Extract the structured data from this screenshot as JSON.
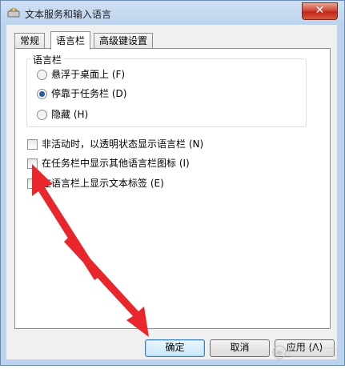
{
  "window": {
    "title": "文本服务和输入语言",
    "close_glyph": "✕"
  },
  "tabs": [
    {
      "label": "常规",
      "active": false
    },
    {
      "label": "语言栏",
      "active": true
    },
    {
      "label": "高级键设置",
      "active": false
    }
  ],
  "language_bar_group": {
    "legend": "语言栏",
    "options": [
      {
        "label": "悬浮于桌面上 (F)",
        "selected": false
      },
      {
        "label": "停靠于任务栏 (D)",
        "selected": true
      },
      {
        "label": "隐藏 (H)",
        "selected": false
      }
    ]
  },
  "checkboxes": [
    {
      "label": "非活动时，以透明状态显示语言栏 (N)",
      "checked": false
    },
    {
      "label": "在任务栏中显示其他语言栏图标 (I)",
      "checked": false
    },
    {
      "label": "在语言栏上显示文本标签 (E)",
      "checked": false
    }
  ],
  "buttons": {
    "ok": "确定",
    "cancel": "取消",
    "apply": "应用 (A)"
  },
  "annotation_color": "#e8262b"
}
